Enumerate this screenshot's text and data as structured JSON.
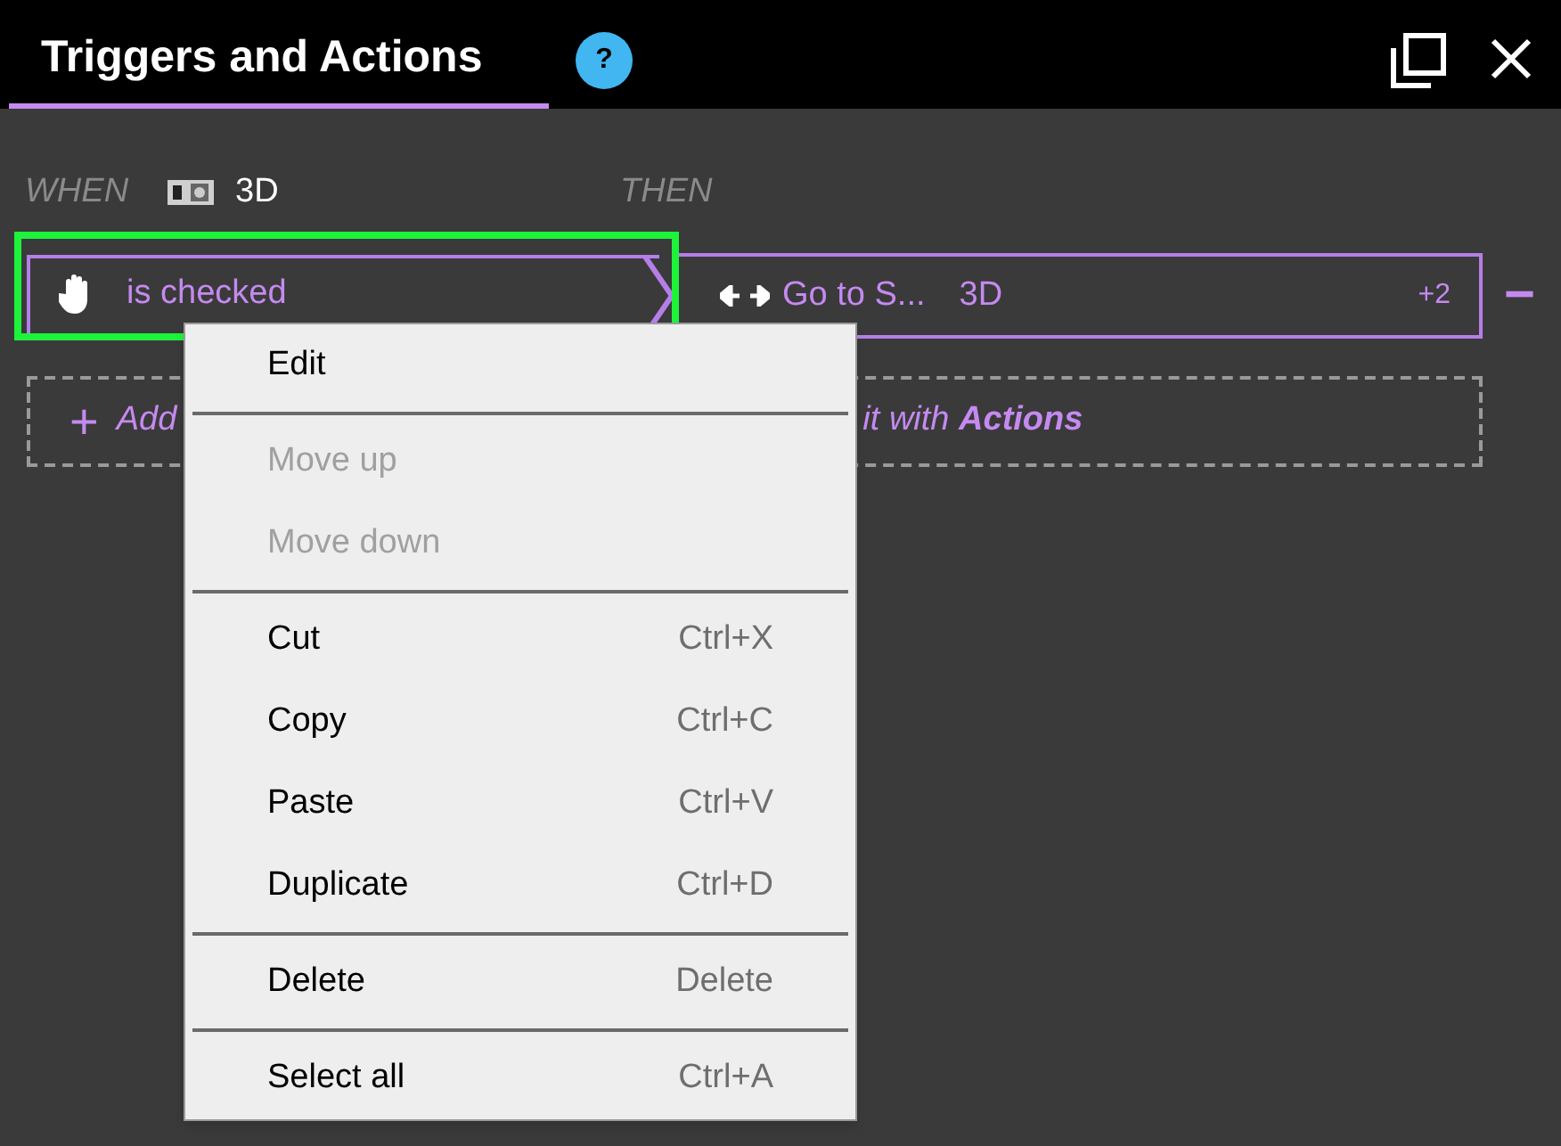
{
  "panel": {
    "title": "Triggers and Actions",
    "help": "?"
  },
  "when": {
    "label": "WHEN",
    "target": "3D"
  },
  "then": {
    "label": "THEN"
  },
  "trigger": {
    "event": "is checked",
    "selected": true
  },
  "action": {
    "name": "Go to S...",
    "target": "3D",
    "more": "+2",
    "remove": "−"
  },
  "add_row": {
    "icon": "+",
    "text_left": "Add",
    "text_right": "it with **Actions**"
  },
  "context_menu": [
    {
      "kind": "item",
      "label": "Edit",
      "disabled": false
    },
    {
      "kind": "separator"
    },
    {
      "kind": "item",
      "label": "Move up",
      "disabled": true
    },
    {
      "kind": "item",
      "label": "Move down",
      "disabled": true
    },
    {
      "kind": "separator"
    },
    {
      "kind": "item",
      "label": "Cut",
      "shortcut": "Ctrl+X",
      "disabled": false
    },
    {
      "kind": "item",
      "label": "Copy",
      "shortcut": "Ctrl+C",
      "disabled": false
    },
    {
      "kind": "item",
      "label": "Paste",
      "shortcut": "Ctrl+V",
      "disabled": false
    },
    {
      "kind": "item",
      "label": "Duplicate",
      "shortcut": "Ctrl+D",
      "disabled": false
    },
    {
      "kind": "separator"
    },
    {
      "kind": "item",
      "label": "Delete",
      "shortcut": "Delete",
      "disabled": false
    },
    {
      "kind": "separator"
    },
    {
      "kind": "item",
      "label": "Select all",
      "shortcut": "Ctrl+A",
      "disabled": false
    }
  ]
}
